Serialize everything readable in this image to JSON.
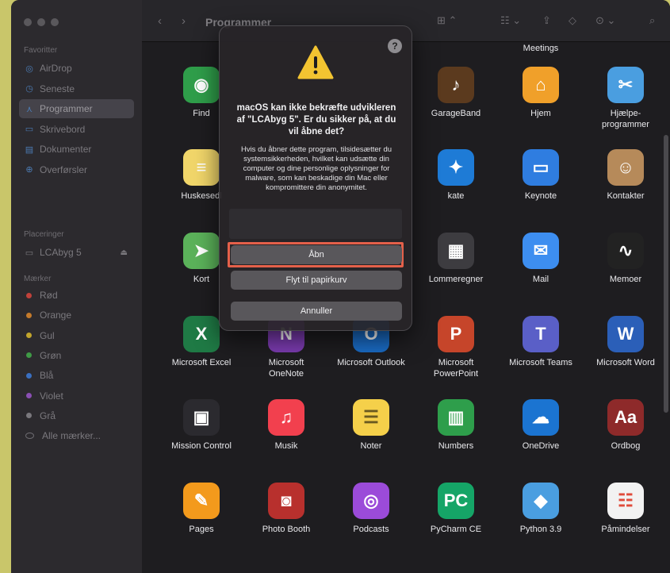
{
  "sidebar": {
    "favorites_title": "Favoritter",
    "favorites": [
      {
        "label": "AirDrop",
        "icon": "airdrop-icon"
      },
      {
        "label": "Seneste",
        "icon": "clock-icon"
      },
      {
        "label": "Programmer",
        "icon": "applications-icon",
        "active": true
      },
      {
        "label": "Skrivebord",
        "icon": "desktop-icon"
      },
      {
        "label": "Dokumenter",
        "icon": "document-icon"
      },
      {
        "label": "Overførsler",
        "icon": "download-icon"
      }
    ],
    "locations_title": "Placeringer",
    "locations": [
      {
        "label": "LCAbyg 5",
        "icon": "disk-icon"
      }
    ],
    "tags_title": "Mærker",
    "tags": [
      {
        "label": "Rød",
        "color": "#c0413a"
      },
      {
        "label": "Orange",
        "color": "#c47a2b"
      },
      {
        "label": "Gul",
        "color": "#c2a52c"
      },
      {
        "label": "Grøn",
        "color": "#3f9a46"
      },
      {
        "label": "Blå",
        "color": "#3a6fc0"
      },
      {
        "label": "Violet",
        "color": "#8a4fb3"
      },
      {
        "label": "Grå",
        "color": "#7a787d"
      },
      {
        "label": "Alle mærker...",
        "color": ""
      }
    ]
  },
  "toolbar": {
    "title": "Programmer"
  },
  "apps": [
    {
      "label": "Find",
      "icon": "find-my-icon",
      "color": "#2f9e4a"
    },
    {
      "label": "",
      "icon": "",
      "color": ""
    },
    {
      "label": "",
      "icon": "",
      "color": ""
    },
    {
      "label": "GarageBand",
      "icon": "garageband-icon",
      "color": "#5b3a1e"
    },
    {
      "label": "Hjem",
      "icon": "home-icon",
      "color": "#f0a02a"
    },
    {
      "label": "Hjælpe-\nprogrammer",
      "icon": "utilities-folder-icon",
      "color": "#4a9ee0"
    },
    {
      "label": "Huskesedl",
      "icon": "stickies-icon",
      "color": "#f1d66a"
    },
    {
      "label": "",
      "icon": "",
      "color": ""
    },
    {
      "label": "",
      "icon": "",
      "color": ""
    },
    {
      "label": "kate",
      "icon": "kate-icon",
      "color": "#1e7bd6"
    },
    {
      "label": "Keynote",
      "icon": "keynote-icon",
      "color": "#2f7de0"
    },
    {
      "label": "Kontakter",
      "icon": "contacts-icon",
      "color": "#b68a5a"
    },
    {
      "label": "Kort",
      "icon": "maps-icon",
      "color": "#5bb25a"
    },
    {
      "label": "",
      "icon": "",
      "color": ""
    },
    {
      "label": "",
      "icon": "",
      "color": ""
    },
    {
      "label": "Lommeregner",
      "icon": "calculator-icon",
      "color": "#3d3c40"
    },
    {
      "label": "Mail",
      "icon": "mail-icon",
      "color": "#3d8ef0"
    },
    {
      "label": "Memoer",
      "icon": "voice-memos-icon",
      "color": "#222"
    },
    {
      "label": "Microsoft Excel",
      "icon": "excel-icon",
      "color": "#1f7a45"
    },
    {
      "label": "Microsoft\nOneNote",
      "icon": "onenote-icon",
      "color": "#7b3bb0"
    },
    {
      "label": "Microsoft Outlook",
      "icon": "outlook-icon",
      "color": "#1a6bc4"
    },
    {
      "label": "Microsoft\nPowerPoint",
      "icon": "powerpoint-icon",
      "color": "#c6452a"
    },
    {
      "label": "Microsoft Teams",
      "icon": "teams-icon",
      "color": "#5a5fc7"
    },
    {
      "label": "Microsoft Word",
      "icon": "word-icon",
      "color": "#2b5fb8"
    },
    {
      "label": "Mission Control",
      "icon": "mission-control-icon",
      "color": "#2b2a2f"
    },
    {
      "label": "Musik",
      "icon": "music-icon",
      "color": "#f2404e"
    },
    {
      "label": "Noter",
      "icon": "notes-icon",
      "color": "#f5d04a"
    },
    {
      "label": "Numbers",
      "icon": "numbers-icon",
      "color": "#2e9e4b"
    },
    {
      "label": "OneDrive",
      "icon": "onedrive-icon",
      "color": "#1b74d1"
    },
    {
      "label": "Ordbog",
      "icon": "dictionary-icon",
      "color": "#8e2a2a"
    },
    {
      "label": "Pages",
      "icon": "pages-icon",
      "color": "#f39a1c"
    },
    {
      "label": "Photo Booth",
      "icon": "photo-booth-icon",
      "color": "#b8302d"
    },
    {
      "label": "Podcasts",
      "icon": "podcasts-icon",
      "color": "#9b4bd9"
    },
    {
      "label": "PyCharm CE",
      "icon": "pycharm-icon",
      "color": "#15a567"
    },
    {
      "label": "Python 3.9",
      "icon": "python-folder-icon",
      "color": "#4a9ee0"
    },
    {
      "label": "Påmindelser",
      "icon": "reminders-icon",
      "color": "#f2f2f2"
    }
  ],
  "header_label": "Meetings",
  "dialog": {
    "title": "macOS kan ikke bekræfte udvikleren af \"LCAbyg 5\". Er du sikker på, at du vil åbne det?",
    "body": "Hvis du åbner dette program, tilsidesætter du systemsikkerheden, hvilket kan udsætte din computer og dine personlige oplysninger for malware, som kan beskadige din Mac eller kompromittere din anonymitet.",
    "open_label": "Åbn",
    "trash_label": "Flyt til papirkurv",
    "cancel_label": "Annuller",
    "help_label": "?"
  }
}
